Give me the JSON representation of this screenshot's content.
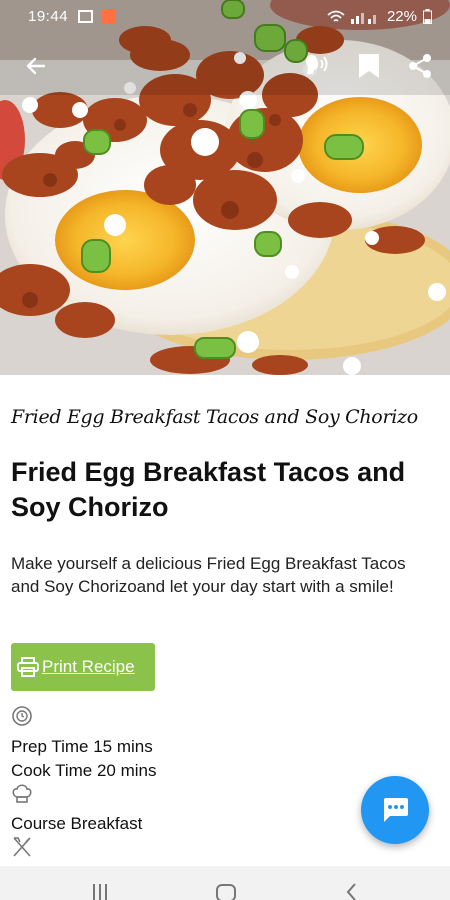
{
  "status_bar": {
    "time": "19:44",
    "battery": "22%"
  },
  "toolbar": {
    "back_icon": "arrow-left-icon",
    "tts_icon": "speak-icon",
    "bookmark_icon": "bookmark-icon",
    "share_icon": "share-icon"
  },
  "hero": {
    "image": "fried-egg-tacos-photo"
  },
  "recipe": {
    "small_title": "Fried Egg Breakfast Tacos and Soy Chorizo",
    "title": "Fried Egg Breakfast Tacos and Soy Chorizo",
    "description": "Make yourself a delicious Fried Egg Breakfast Tacos and Soy Chorizoand let your day start with a smile!",
    "print_label": "Print Recipe",
    "prep_time": "Prep Time 15 mins",
    "cook_time": "Cook Time 20 mins",
    "course": "Course Breakfast"
  },
  "fab": {
    "icon": "chat-icon"
  },
  "colors": {
    "print_button": "#8bc34a",
    "fab": "#2196f3"
  }
}
